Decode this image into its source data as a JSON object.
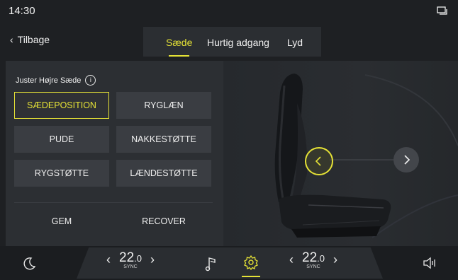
{
  "status": {
    "time": "14:30",
    "icon": "window-switch-icon"
  },
  "header": {
    "back_label": "Tilbage",
    "tabs": [
      {
        "label": "Sæde",
        "active": true
      },
      {
        "label": "Hurtig adgang",
        "active": false
      },
      {
        "label": "Lyd",
        "active": false
      }
    ]
  },
  "panel": {
    "title": "Juster Højre Sæde",
    "info_icon": "i",
    "buttons": [
      {
        "label": "SÆDEPOSITION",
        "selected": true
      },
      {
        "label": "RYGLÆN",
        "selected": false
      },
      {
        "label": "PUDE",
        "selected": false
      },
      {
        "label": "NAKKESTØTTE",
        "selected": false
      },
      {
        "label": "RYGSTØTTE",
        "selected": false
      },
      {
        "label": "LÆNDESTØTTE",
        "selected": false
      }
    ],
    "save_label": "GEM",
    "recover_label": "RECOVER"
  },
  "bottom": {
    "left_temp": {
      "value": "22",
      "decimal": ".0",
      "sync": "SYNC"
    },
    "right_temp": {
      "value": "22",
      "decimal": ".0",
      "sync": "SYNC"
    },
    "icons": [
      "moon-icon",
      "music-note-icon",
      "settings-gear-icon",
      "volume-icon"
    ]
  },
  "colors": {
    "accent": "#e5e236",
    "background": "#1e2023",
    "panel": "#2c2f33",
    "button": "#3a3d42"
  }
}
